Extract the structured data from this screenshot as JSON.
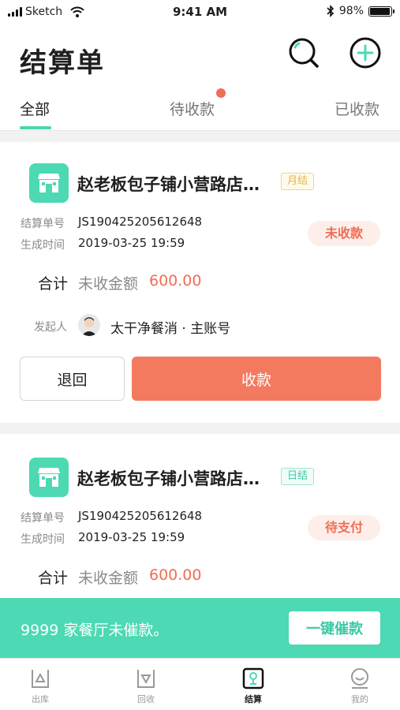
{
  "status_bar": {
    "carrier": "Sketch",
    "time": "9:41 AM",
    "battery": "98%",
    "battery_level": 0.98
  },
  "header": {
    "title": "结算单",
    "search_icon": "search-icon",
    "add_icon": "add-icon"
  },
  "tabs": [
    {
      "label": "全部",
      "active": true
    },
    {
      "label": "待收款",
      "active": false,
      "has_dot": true
    },
    {
      "label": "已收款",
      "active": false
    }
  ],
  "cards": [
    {
      "shop_name": "赵老板包子铺小营路店…",
      "tag": "月结",
      "tag_color": "#e3b34b",
      "order_no_label": "结算单号",
      "order_no": "JS190425205612648",
      "created_label": "生成时间",
      "created": "2019-03-25 19:59",
      "status": "未收款",
      "total_label": "合计",
      "unpaid_label": "未收金额",
      "amount": "600.00",
      "initiator_label": "发起人",
      "initiator": "太干净餐消 · 主账号",
      "return_label": "退回",
      "collect_label": "收款"
    },
    {
      "shop_name": "赵老板包子铺小营路店…",
      "tag": "日结",
      "tag_color": "#3cc9a4",
      "order_no_label": "结算单号",
      "order_no": "JS190425205612648",
      "created_label": "生成时间",
      "created": "2019-03-25 19:59",
      "status": "待支付",
      "total_label": "合计",
      "unpaid_label": "未收金额",
      "amount": "600.00"
    }
  ],
  "banner": {
    "text": "9999 家餐厅未催款。",
    "button": "一键催款"
  },
  "tabbar": [
    {
      "label": "出库",
      "icon": "outbound-icon",
      "active": false
    },
    {
      "label": "回收",
      "icon": "recycle-icon",
      "active": false
    },
    {
      "label": "结算",
      "icon": "settlement-icon",
      "active": true
    },
    {
      "label": "我的",
      "icon": "profile-icon",
      "active": false
    }
  ],
  "colors": {
    "accent": "#4cd9b3",
    "alert": "#f16d55",
    "collect_button": "#f47a5f"
  }
}
